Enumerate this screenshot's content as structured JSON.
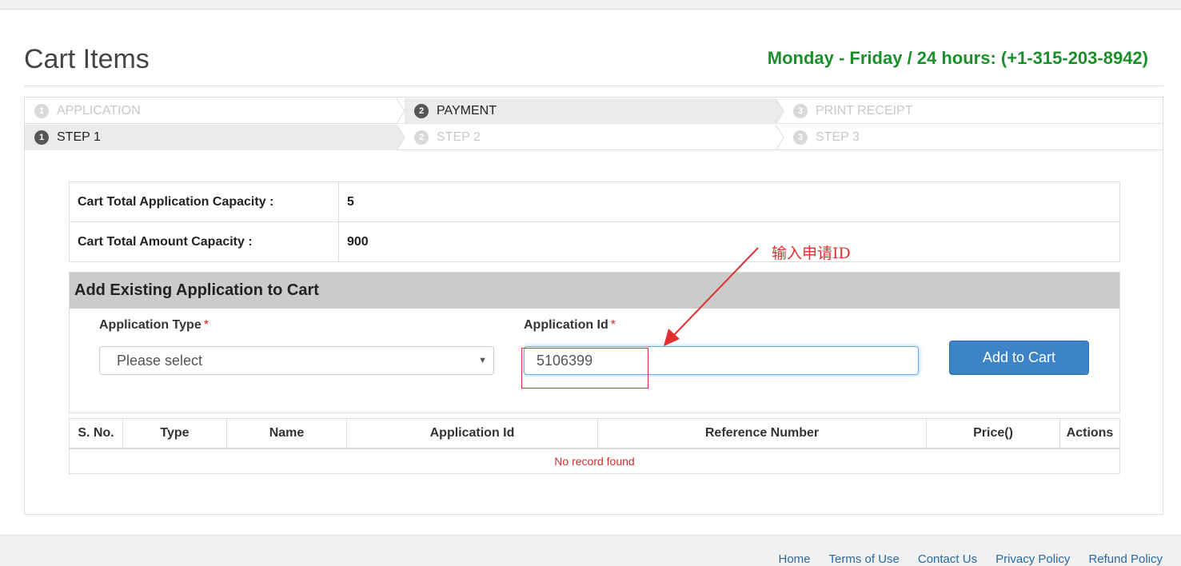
{
  "header": {
    "title": "Cart Items",
    "hours": "Monday - Friday / 24 hours: (+1-315-203-8942)"
  },
  "wizard": {
    "row1": [
      {
        "num": "1",
        "label": "APPLICATION",
        "active": false
      },
      {
        "num": "2",
        "label": "PAYMENT",
        "active": true
      },
      {
        "num": "3",
        "label": "PRINT RECEIPT",
        "active": false
      }
    ],
    "row2": [
      {
        "num": "1",
        "label": "STEP 1",
        "active": true
      },
      {
        "num": "2",
        "label": "STEP 2",
        "active": false
      },
      {
        "num": "3",
        "label": "STEP 3",
        "active": false
      }
    ]
  },
  "capacity": {
    "app_label": "Cart Total Application Capacity :",
    "app_value": "5",
    "amount_label": "Cart Total Amount Capacity :",
    "amount_value": "900"
  },
  "add_form": {
    "heading": "Add Existing Application to Cart",
    "type_label": "Application Type",
    "id_label": "Application Id",
    "required_mark": "*",
    "type_selected": "Please select",
    "id_value": "5106399",
    "add_button": "Add to Cart"
  },
  "annotation": {
    "text": "输入申请ID",
    "color": "#e03030"
  },
  "cart_table": {
    "columns": [
      "S. No.",
      "Type",
      "Name",
      "Application Id",
      "Reference Number",
      "Price()",
      "Actions"
    ],
    "empty_message": "No record found"
  },
  "footer": {
    "links": [
      "Home",
      "Terms of Use",
      "Contact Us",
      "Privacy Policy",
      "Refund Policy"
    ]
  }
}
